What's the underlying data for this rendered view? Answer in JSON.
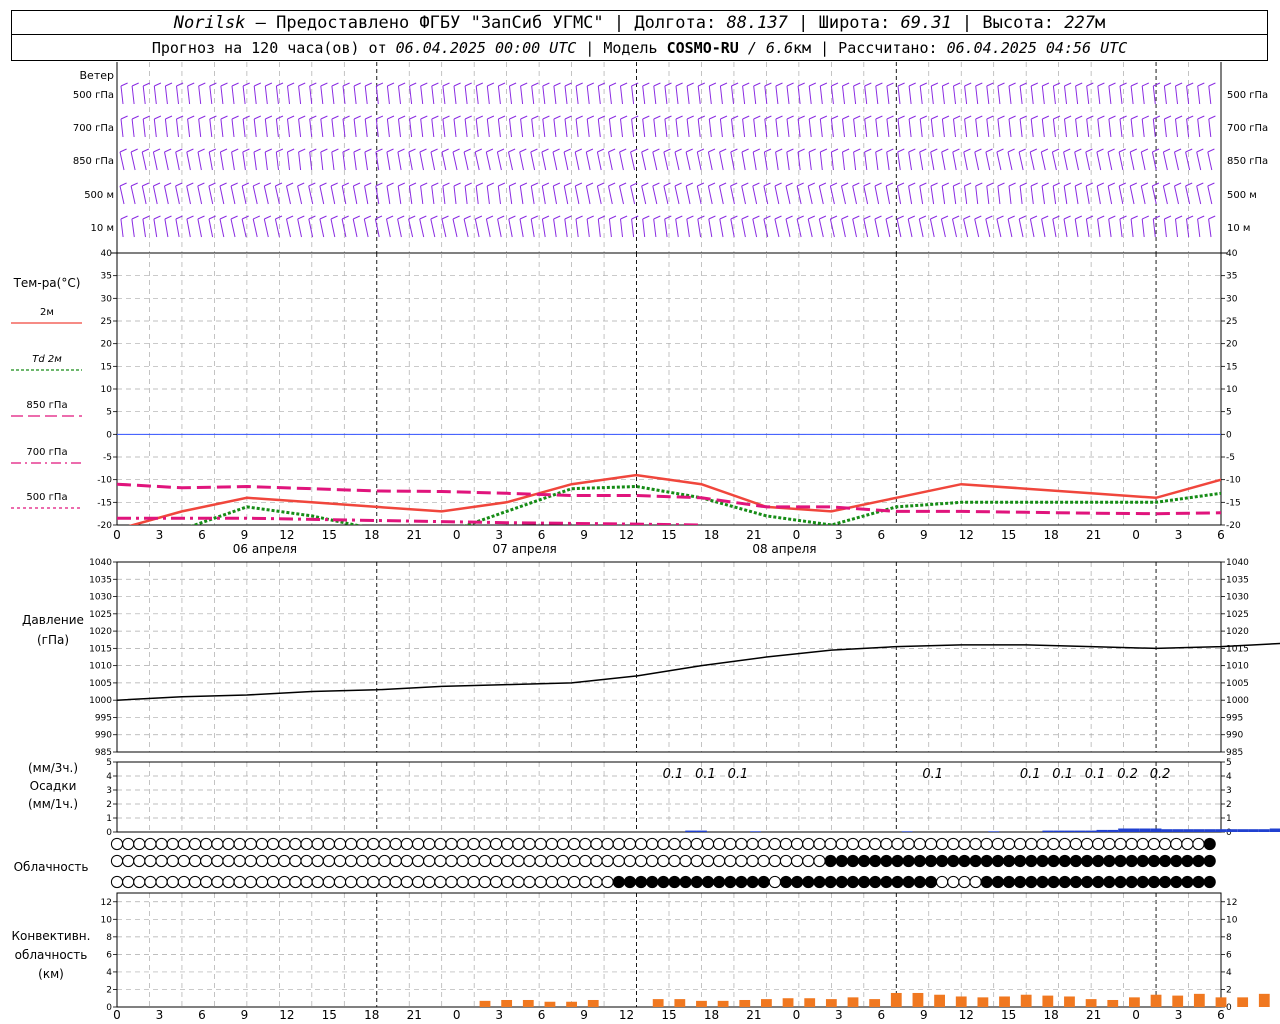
{
  "header": {
    "station": "Norilsk",
    "provider_text": " – Предоставлено ФГБУ \"ЗапСиб УГМС\" | Долгота: ",
    "lon": "88.137",
    "lat_label": " | Широта: ",
    "lat": "69.31",
    "alt_label": " | Высота: ",
    "alt": "227",
    "alt_unit": "м",
    "forecast_label": "Прогноз на 120 часа(ов) от ",
    "forecast_start": "06.04.2025 00:00 UTC",
    "model_label": " | Модель ",
    "model": "COSMO-RU",
    "resolution": " / 6.6",
    "res_unit": "км | Рассчитано: ",
    "computed": "06.04.2025 04:56 UTC"
  },
  "colors": {
    "wind": "#8a2be2",
    "t2m": "#f0463c",
    "td2m": "#168c16",
    "t850": "#e0147c",
    "t700": "#e0147c",
    "t500": "#e0147c",
    "zero_line": "#3050ff",
    "pressure": "#000000",
    "precip": "#2040d0",
    "convective": "#f07820"
  },
  "labels": {
    "wind_title": "Ветер",
    "wind_levels": [
      "500 гПа",
      "700 гПа",
      "850 гПа",
      "500 м",
      "10 м"
    ],
    "temp_title": "Тем-ра(°C)",
    "temp_legend": [
      "2м",
      "Td 2м",
      "850 гПа",
      "700 гПа",
      "500 гПа"
    ],
    "pressure_title": "Давление",
    "pressure_unit": "(гПа)",
    "precip_unit_top": "(мм/3ч.)",
    "precip_title": "Осадки",
    "precip_unit_bottom": "(мм/1ч.)",
    "cloud_title": "Облачность",
    "conv_title_1": "Конвективн.",
    "conv_title_2": "облачность",
    "conv_unit": "(км)"
  },
  "time_axis": {
    "hour_ticks": [
      "0",
      "3",
      "6",
      "9",
      "12",
      "15",
      "18",
      "21",
      "0",
      "3",
      "6",
      "9",
      "12",
      "15",
      "18",
      "21",
      "0",
      "3",
      "6",
      "9",
      "12",
      "15",
      "18",
      "21",
      "0",
      "3",
      "6"
    ],
    "date_labels": [
      "06 апреля",
      "07 апреля",
      "08 апреля"
    ]
  },
  "chart_data": [
    {
      "type": "line",
      "title": "Тем-ра(°C)",
      "x_unit": "hours from 06.04.2025 00:00 UTC",
      "ylim": [
        -20,
        40
      ],
      "yticks": [
        40,
        35,
        30,
        25,
        20,
        15,
        10,
        5,
        0,
        -5,
        -10,
        -15,
        -20
      ],
      "grid": true,
      "series": [
        {
          "name": "2м",
          "x": [
            0,
            6,
            12,
            18,
            24,
            30,
            36,
            42,
            48,
            54,
            60,
            66,
            72,
            78,
            84,
            90,
            96,
            102,
            108
          ],
          "values": [
            -21,
            -17,
            -14,
            -15,
            -16,
            -17,
            -15,
            -11,
            -9,
            -11,
            -16,
            -17,
            -14,
            -11,
            -12,
            -13,
            -14,
            -10,
            -9
          ]
        },
        {
          "name": "Td 2м",
          "x": [
            0,
            6,
            12,
            18,
            24,
            30,
            36,
            42,
            48,
            54,
            60,
            66,
            72,
            78,
            84,
            90,
            96,
            102,
            108
          ],
          "values": [
            -24,
            -21,
            -16,
            -18,
            -21,
            -22,
            -17,
            -12,
            -11.5,
            -14,
            -18,
            -20,
            -16,
            -15,
            -15,
            -15,
            -15,
            -13,
            -11
          ]
        },
        {
          "name": "850 гПа",
          "x": [
            0,
            6,
            12,
            18,
            24,
            30,
            36,
            42,
            48,
            54,
            60,
            66,
            72,
            78,
            84,
            90,
            96,
            102,
            108
          ],
          "values": [
            -11,
            -11.8,
            -11.5,
            -12,
            -12.5,
            -12.6,
            -13,
            -13.5,
            -13.5,
            -14,
            -16,
            -16,
            -17,
            -17,
            -17.2,
            -17.4,
            -17.5,
            -17.3,
            -18.5
          ]
        },
        {
          "name": "700 гПа",
          "x": [
            0,
            12,
            24,
            36,
            48,
            54
          ],
          "values": [
            -18.5,
            -18.5,
            -19,
            -19.5,
            -19.8,
            -20
          ]
        }
      ]
    },
    {
      "type": "line",
      "title": "Давление",
      "x_unit": "hours from 06.04.2025 00:00 UTC",
      "ylim": [
        985,
        1040
      ],
      "yticks": [
        1040,
        1035,
        1030,
        1025,
        1020,
        1015,
        1010,
        1005,
        1000,
        995,
        990,
        985
      ],
      "grid": true,
      "series": [
        {
          "name": "Давление",
          "x": [
            0,
            6,
            12,
            18,
            24,
            30,
            36,
            42,
            48,
            54,
            60,
            66,
            72,
            78,
            84,
            90,
            96,
            102,
            108
          ],
          "values": [
            1000,
            1001,
            1001.5,
            1002.5,
            1003,
            1004,
            1004.5,
            1005,
            1007,
            1010,
            1012.5,
            1014.5,
            1015.5,
            1016,
            1016,
            1015.5,
            1015,
            1015.5,
            1016.5
          ]
        }
      ]
    },
    {
      "type": "bar",
      "title": "Осадки",
      "x_unit": "hours from 06.04.2025 00:00 UTC",
      "ylim": [
        0,
        5
      ],
      "yticks": [
        5,
        4,
        3,
        2,
        1,
        0
      ],
      "sum_labels": [
        {
          "x": 51,
          "text": "0.1"
        },
        {
          "x": 54,
          "text": "0.1"
        },
        {
          "x": 57,
          "text": "0.1"
        },
        {
          "x": 75,
          "text": "0.1"
        },
        {
          "x": 84,
          "text": "0.1"
        },
        {
          "x": 87,
          "text": "0.1"
        },
        {
          "x": 90,
          "text": "0.1"
        },
        {
          "x": 93,
          "text": "0.2"
        },
        {
          "x": 96,
          "text": "0.2"
        }
      ],
      "x": [
        53,
        54,
        59,
        73,
        81,
        86,
        87,
        88,
        89,
        90,
        91,
        92,
        93,
        94,
        95,
        96,
        97,
        98,
        99,
        100,
        101,
        102,
        103,
        104,
        105,
        106,
        107,
        108
      ],
      "values": [
        0.1,
        0.1,
        0.05,
        0.05,
        0.05,
        0.1,
        0.1,
        0.1,
        0.1,
        0.1,
        0.15,
        0.15,
        0.25,
        0.25,
        0.25,
        0.25,
        0.2,
        0.2,
        0.2,
        0.2,
        0.2,
        0.2,
        0.2,
        0.2,
        0.2,
        0.2,
        0.25,
        0.2
      ]
    },
    {
      "type": "area",
      "title": "Конвективн. облачность",
      "x_unit": "hours from 06.04.2025 00:00 UTC",
      "ylim": [
        0,
        13
      ],
      "yticks": [
        12,
        10,
        8,
        6,
        4,
        2,
        0
      ],
      "x": [
        34,
        36,
        38,
        40,
        42,
        44,
        50,
        52,
        54,
        56,
        58,
        60,
        62,
        64,
        66,
        68,
        70,
        72,
        74,
        76,
        78,
        80,
        82,
        84,
        86,
        88,
        90,
        92,
        94,
        96,
        98,
        100,
        102,
        104,
        106,
        108
      ],
      "values": [
        0.7,
        0.8,
        0.8,
        0.6,
        0.6,
        0.8,
        0.9,
        0.9,
        0.7,
        0.7,
        0.8,
        0.9,
        1.0,
        1.0,
        0.9,
        1.1,
        0.9,
        1.6,
        1.6,
        1.4,
        1.2,
        1.1,
        1.2,
        1.4,
        1.3,
        1.2,
        0.9,
        0.8,
        1.1,
        1.4,
        1.3,
        1.5,
        1.1,
        1.1,
        1.5,
        1.4
      ]
    }
  ],
  "cloud_rows": {
    "row1": "ooooooooooooooooooooooooooooooooooooooooooooooooooooooooooooooooooooooooooooooooooooooooooooooooo",
    "row2": "hooooooooooooooooooooooooooooooooooooooooooooooooooooooooooooooooooooooooooooooooooooooooooooooooo",
    "row3": "ooooooooooooooooooooooooooooooooooooooooooooooooooooooooooooooooooooooooooooooooooooooooooooooooo"
  }
}
